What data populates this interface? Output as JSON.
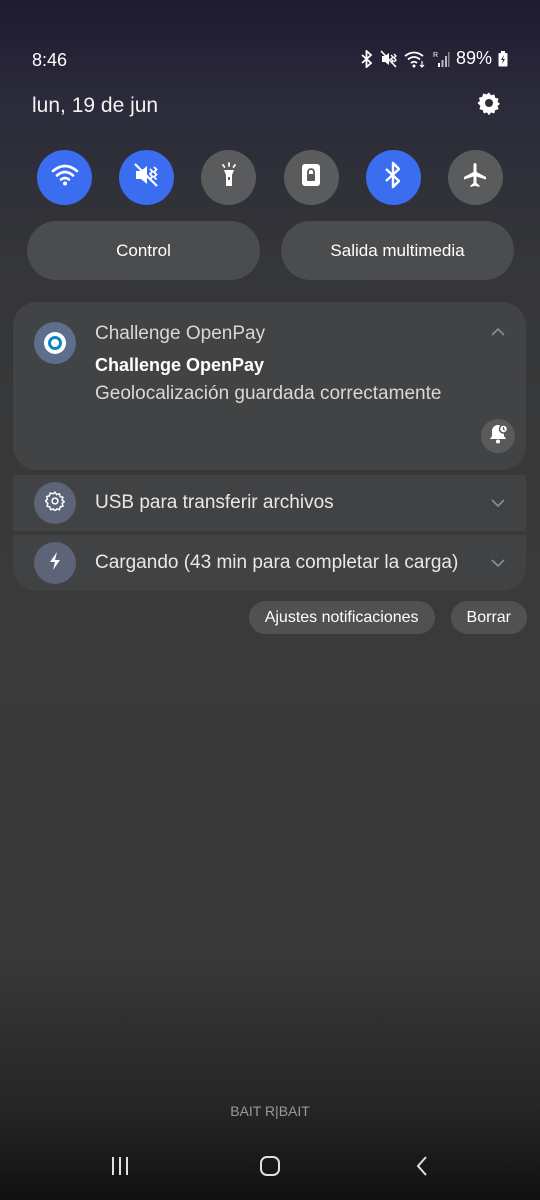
{
  "status_bar": {
    "time": "8:46",
    "battery_percent": "89%",
    "icons": [
      "bluetooth-icon",
      "mute-vibrate-icon",
      "wifi-icon",
      "signal-icon",
      "battery-charging-icon"
    ]
  },
  "header": {
    "date": "lun, 19 de jun",
    "settings_icon": "gear-icon"
  },
  "quick_settings": {
    "tiles": [
      {
        "name": "wifi",
        "icon": "wifi-icon",
        "state": "on"
      },
      {
        "name": "sound",
        "icon": "mute-vibrate-icon",
        "state": "on"
      },
      {
        "name": "flashlight",
        "icon": "flashlight-icon",
        "state": "off"
      },
      {
        "name": "rotation-lock",
        "icon": "lock-icon",
        "state": "off"
      },
      {
        "name": "bluetooth",
        "icon": "bluetooth-icon",
        "state": "on"
      },
      {
        "name": "airplane",
        "icon": "airplane-icon",
        "state": "off"
      }
    ],
    "accent_color": "#3a6df0",
    "off_color": "#5a5b5d"
  },
  "pills": {
    "control_label": "Control",
    "media_label": "Salida multimedia"
  },
  "notifications": {
    "openpay": {
      "app_name": "Challenge OpenPay",
      "title": "Challenge OpenPay",
      "body": "Geolocalización guardada correctamente"
    },
    "usb": {
      "label": "USB para transferir archivos"
    },
    "charging": {
      "label": "Cargando (43 min para completar la carga)"
    }
  },
  "actions": {
    "settings_label": "Ajustes notificaciones",
    "clear_label": "Borrar"
  },
  "carrier": "BAIT R|BAIT",
  "nav": {
    "recents": "recents-icon",
    "home": "home-icon",
    "back": "back-icon"
  }
}
